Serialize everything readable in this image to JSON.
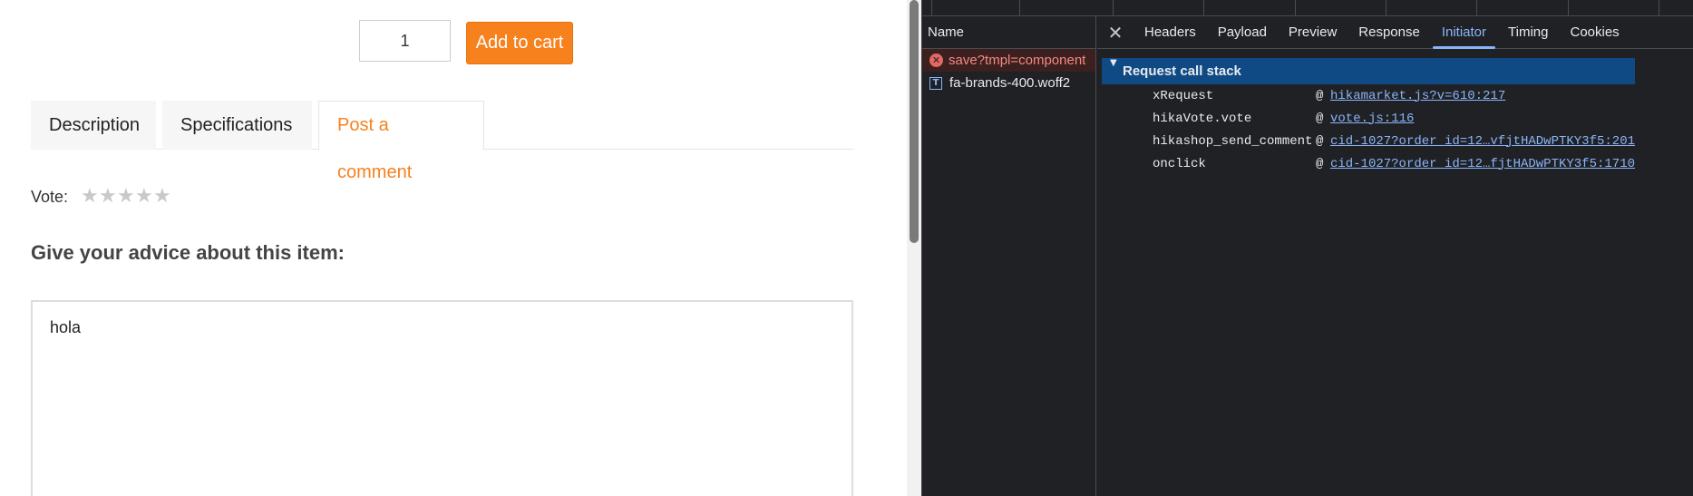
{
  "product": {
    "quantity": "1",
    "add_to_cart_label": "Add to cart"
  },
  "tabs": [
    {
      "label": "Description",
      "active": false
    },
    {
      "label": "Specifications",
      "active": false
    },
    {
      "label": "Post a comment",
      "active": true
    }
  ],
  "vote": {
    "label": "Vote:",
    "stars": 5,
    "rating": 0
  },
  "comment": {
    "heading": "Give your advice about this item:",
    "value": "hola"
  },
  "colors": {
    "accent": "#f7811d",
    "devtools_bg": "#202124",
    "devtools_link": "#8ab4f8",
    "error_red": "#f28b82",
    "selection_blue": "#0f4a85"
  },
  "devtools": {
    "name_header": "Name",
    "requests": [
      {
        "name": "save?tmpl=component",
        "icon": "error-icon",
        "status": "failed",
        "selected": true
      },
      {
        "name": "fa-brands-400.woff2",
        "icon": "font-file-icon",
        "status": "ok",
        "selected": false
      }
    ],
    "close_icon": "close-icon",
    "detail_tabs": [
      {
        "label": "Headers",
        "active": false
      },
      {
        "label": "Payload",
        "active": false
      },
      {
        "label": "Preview",
        "active": false
      },
      {
        "label": "Response",
        "active": false
      },
      {
        "label": "Initiator",
        "active": true
      },
      {
        "label": "Timing",
        "active": false
      },
      {
        "label": "Cookies",
        "active": false
      }
    ],
    "call_stack": {
      "title": "Request call stack",
      "expanded": true,
      "frames": [
        {
          "function": "xRequest",
          "at": "@",
          "location": "hikamarket.js?v=610:217"
        },
        {
          "function": "hikaVote.vote",
          "at": "@",
          "location": "vote.js:116"
        },
        {
          "function": "hikashop_send_comment",
          "at": "@",
          "location": "cid-1027?order_id=12…vfjtHADwPTKY3f5:201"
        },
        {
          "function": "onclick",
          "at": "@",
          "location": "cid-1027?order_id=12…fjtHADwPTKY3f5:1710"
        }
      ]
    }
  }
}
